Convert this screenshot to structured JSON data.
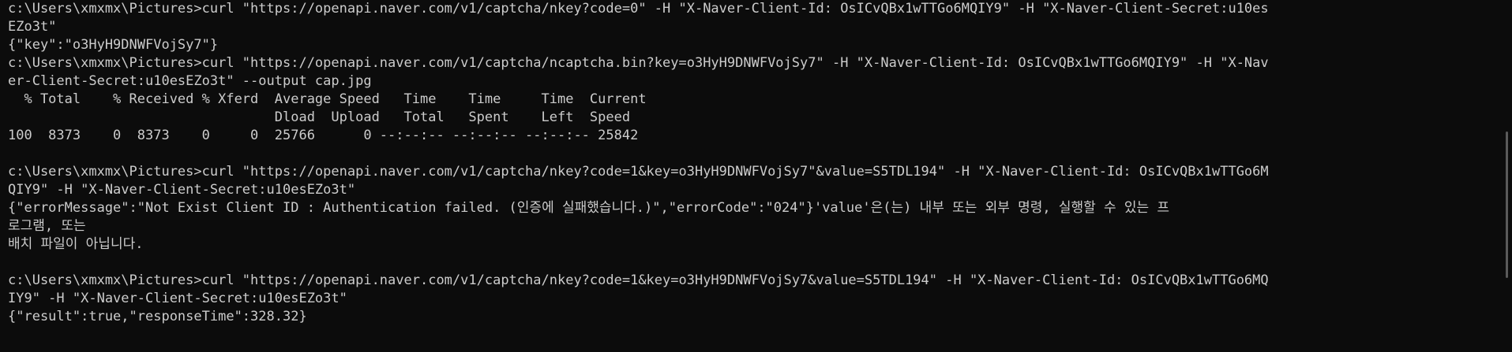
{
  "terminal": {
    "lines": [
      "c:\\Users\\xmxmx\\Pictures>curl \"https://openapi.naver.com/v1/captcha/nkey?code=0\" -H \"X-Naver-Client-Id: OsICvQBx1wTTGo6MQIY9\" -H \"X-Naver-Client-Secret:u10es",
      "EZo3t\"",
      "{\"key\":\"o3HyH9DNWFVojSy7\"}",
      "c:\\Users\\xmxmx\\Pictures>curl \"https://openapi.naver.com/v1/captcha/ncaptcha.bin?key=o3HyH9DNWFVojSy7\" -H \"X-Naver-Client-Id: OsICvQBx1wTTGo6MQIY9\" -H \"X-Nav",
      "er-Client-Secret:u10esEZo3t\" --output cap.jpg",
      "  % Total    % Received % Xferd  Average Speed   Time    Time     Time  Current",
      "                                 Dload  Upload   Total   Spent    Left  Speed",
      "100  8373    0  8373    0     0  25766      0 --:--:-- --:--:-- --:--:-- 25842",
      "",
      "c:\\Users\\xmxmx\\Pictures>curl \"https://openapi.naver.com/v1/captcha/nkey?code=1&key=o3HyH9DNWFVojSy7\"&value=S5TDL194\" -H \"X-Naver-Client-Id: OsICvQBx1wTTGo6M",
      "QIY9\" -H \"X-Naver-Client-Secret:u10esEZo3t\"",
      "{\"errorMessage\":\"Not Exist Client ID : Authentication failed. (인증에 실패했습니다.)\",\"errorCode\":\"024\"}'value'은(는) 내부 또는 외부 명령, 실행할 수 있는 프",
      "로그램, 또는",
      "배치 파일이 아닙니다.",
      "",
      "c:\\Users\\xmxmx\\Pictures>curl \"https://openapi.naver.com/v1/captcha/nkey?code=1&key=o3HyH9DNWFVojSy7&value=S5TDL194\" -H \"X-Naver-Client-Id: OsICvQBx1wTTGo6MQ",
      "IY9\" -H \"X-Naver-Client-Secret:u10esEZo3t\"",
      "{\"result\":true,\"responseTime\":328.32}"
    ]
  },
  "colors": {
    "background": "#0c0c0c",
    "text": "#cccccc",
    "scrollbar_thumb": "#5a5a5a"
  }
}
